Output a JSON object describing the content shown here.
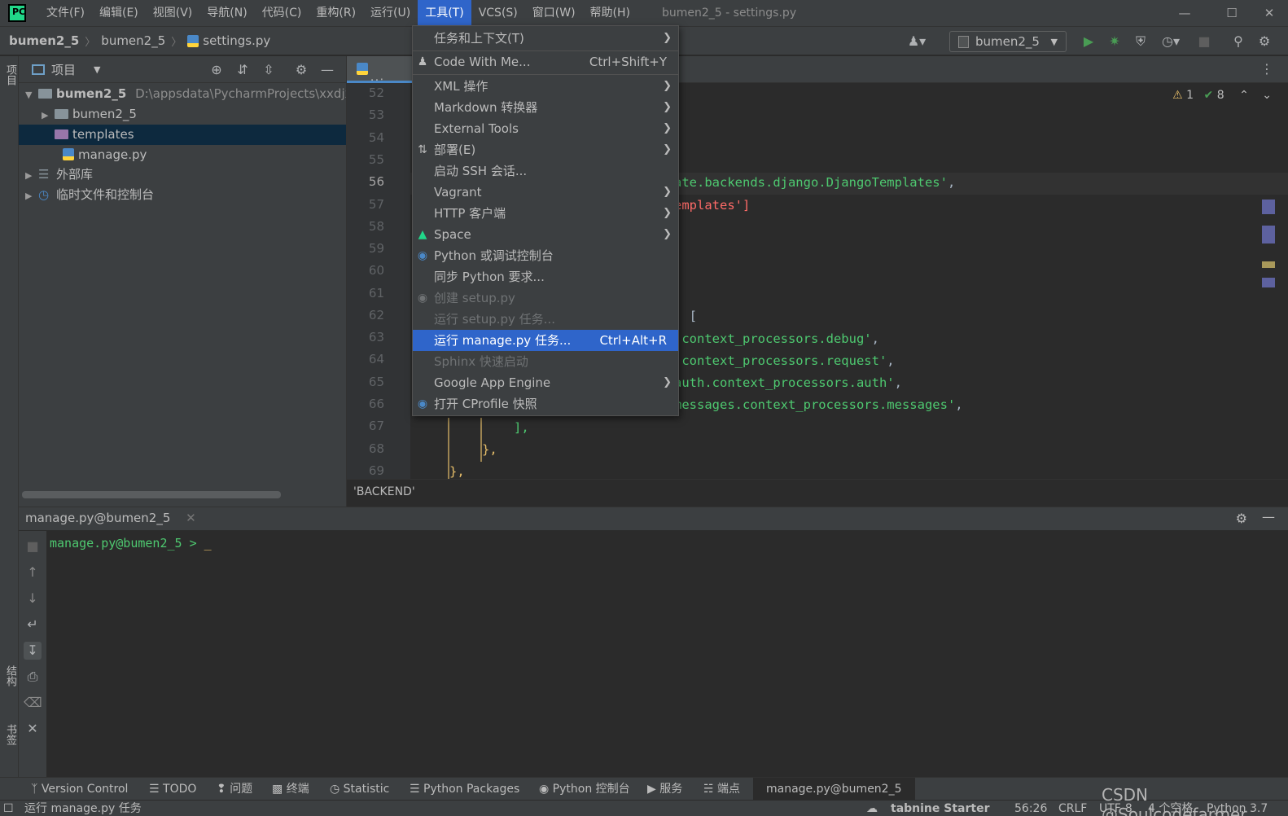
{
  "menubar": {
    "items": [
      "文件(F)",
      "编辑(E)",
      "视图(V)",
      "导航(N)",
      "代码(C)",
      "重构(R)",
      "运行(U)",
      "工具(T)",
      "VCS(S)",
      "窗口(W)",
      "帮助(H)"
    ],
    "window_title": "bumen2_5 - settings.py"
  },
  "navbar": {
    "crumbs": [
      "bumen2_5",
      "bumen2_5",
      "settings.py"
    ],
    "run_config": "bumen2_5"
  },
  "stripe": {
    "project": "项目",
    "structure": "结构",
    "bookmarks": "书签"
  },
  "project": {
    "header": "项目",
    "tree": [
      {
        "label": "bumen2_5",
        "path": "D:\\appsdata\\PycharmProjects\\xxdjx"
      },
      {
        "label": "bumen2_5"
      },
      {
        "label": "templates"
      },
      {
        "label": "manage.py"
      },
      {
        "label": "外部库"
      },
      {
        "label": "临时文件和控制台"
      }
    ]
  },
  "editor": {
    "tab": "settings.py",
    "line_numbers": [
      "52",
      "53",
      "54",
      "55",
      "56",
      "57",
      "58",
      "59",
      "60",
      "61",
      "62",
      "63",
      "64",
      "65",
      "66",
      "67",
      "68",
      "69"
    ],
    "inspection_warn": "1",
    "inspection_ok": "8",
    "lines": {
      "l56": "ate.backends.django.DjangoTemplates'",
      "l57": "emplates']",
      "l62": ": [",
      "l63": ".context_processors.debug'",
      "l64": ".context_processors.request'",
      "l65": "auth.context_processors.auth'",
      "l66": "messages.context_processors.messages'",
      "l67": "],",
      "l68": "},",
      "l69": "},"
    },
    "breadcrumb": "'BACKEND'"
  },
  "tools_menu": {
    "items": [
      {
        "label": "任务和上下文(T)",
        "submenu": true
      },
      {
        "label": "Code With Me...",
        "shortcut": "Ctrl+Shift+Y"
      },
      {
        "label": "XML 操作",
        "submenu": true
      },
      {
        "label": "Markdown 转换器",
        "submenu": true
      },
      {
        "label": "External Tools",
        "submenu": true
      },
      {
        "label": "部署(E)",
        "submenu": true
      },
      {
        "label": "启动 SSH 会话..."
      },
      {
        "label": "Vagrant",
        "submenu": true
      },
      {
        "label": "HTTP 客户端",
        "submenu": true
      },
      {
        "label": "Space",
        "submenu": true
      },
      {
        "label": "Python 或调试控制台"
      },
      {
        "label": "同步 Python 要求..."
      },
      {
        "label": "创建 setup.py",
        "disabled": true
      },
      {
        "label": "运行 setup.py 任务...",
        "disabled": true
      },
      {
        "label": "运行 manage.py 任务...",
        "shortcut": "Ctrl+Alt+R",
        "highlight": true
      },
      {
        "label": "Sphinx 快速启动",
        "disabled": true
      },
      {
        "label": "Google App Engine",
        "submenu": true
      },
      {
        "label": "打开 CProfile 快照"
      }
    ]
  },
  "terminal": {
    "tab": "manage.py@bumen2_5",
    "prompt": "manage.py@bumen2_5 >",
    "cursor": "_"
  },
  "bottom_tools": [
    "Version Control",
    "TODO",
    "问题",
    "终端",
    "Statistic",
    "Python Packages",
    "Python 控制台",
    "服务",
    "端点",
    "manage.py@bumen2_5"
  ],
  "statusbar": {
    "message": "运行 manage.py 任务",
    "tabnine": "tabnine Starter",
    "position": "56:26",
    "line_sep": "CRLF",
    "encoding": "UTF-8",
    "indent": "4 个空格",
    "interpreter": "Python 3.7"
  },
  "watermark": "CSDN @Soulcodefarmer",
  "colors": {
    "accent": "#2f65ca",
    "selection": "#0d293e",
    "string_green": "#4ec970",
    "error_red": "#ff6b68"
  }
}
